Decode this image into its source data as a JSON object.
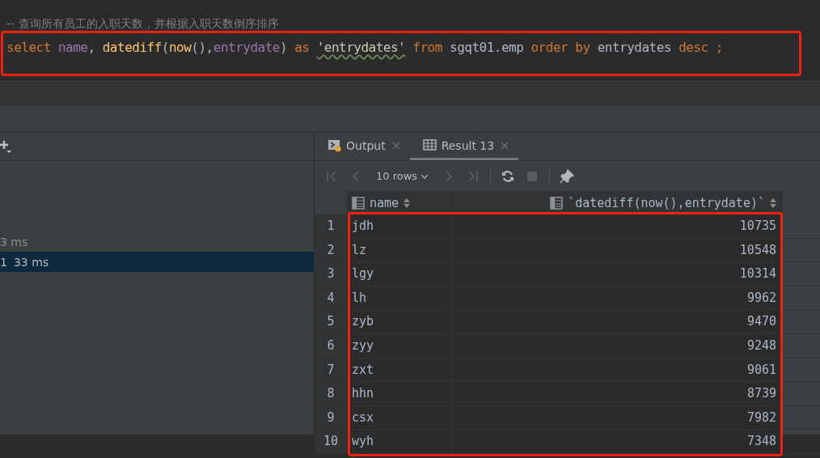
{
  "editor": {
    "comment": "-- 查询所有员工的入职天数，并根据入职天数倒序排序",
    "statement": [
      {
        "kind": "keyword",
        "text": "select"
      },
      {
        "kind": "column",
        "text": " name"
      },
      {
        "kind": "plain",
        "text": ", "
      },
      {
        "kind": "function",
        "text": "datediff"
      },
      {
        "kind": "plain",
        "text": "("
      },
      {
        "kind": "function",
        "text": "now"
      },
      {
        "kind": "plain",
        "text": "(),"
      },
      {
        "kind": "column",
        "text": "entrydate"
      },
      {
        "kind": "plain",
        "text": ") "
      },
      {
        "kind": "keyword",
        "text": "as "
      },
      {
        "kind": "string",
        "text": "'entrydates'",
        "typo": true
      },
      {
        "kind": "keyword",
        "text": " from "
      },
      {
        "kind": "plain",
        "text": "sgqt01.emp "
      },
      {
        "kind": "keyword",
        "text": "order by "
      },
      {
        "kind": "plain",
        "text": "entrydates "
      },
      {
        "kind": "keyword",
        "text": "desc ;"
      }
    ],
    "highlighted": true
  },
  "services": {
    "rows": [
      {
        "number": "",
        "time": "3 ms",
        "selected": false
      },
      {
        "number": "1",
        "time": "33 ms",
        "selected": true
      }
    ]
  },
  "results": {
    "tabs": [
      {
        "label": "Output",
        "kind": "output",
        "selected": false
      },
      {
        "label": "Result 13",
        "kind": "table",
        "selected": true
      }
    ],
    "page_size": "10 rows",
    "columns": [
      {
        "label": "name"
      },
      {
        "label": "`datediff(now(),entrydate)`"
      }
    ],
    "rows": [
      {
        "number": "1",
        "cells": [
          "jdh",
          "10735"
        ]
      },
      {
        "number": "2",
        "cells": [
          "lz",
          "10548"
        ]
      },
      {
        "number": "3",
        "cells": [
          "lgy",
          "10314"
        ]
      },
      {
        "number": "4",
        "cells": [
          "lh",
          "9962"
        ]
      },
      {
        "number": "5",
        "cells": [
          "zyb",
          "9470"
        ]
      },
      {
        "number": "6",
        "cells": [
          "zyy",
          "9248"
        ]
      },
      {
        "number": "7",
        "cells": [
          "zxt",
          "9061"
        ]
      },
      {
        "number": "8",
        "cells": [
          "hhn",
          "8739"
        ]
      },
      {
        "number": "9",
        "cells": [
          "csx",
          "7982"
        ]
      },
      {
        "number": "10",
        "cells": [
          "wyh",
          "7348"
        ]
      }
    ],
    "highlighted": true
  }
}
